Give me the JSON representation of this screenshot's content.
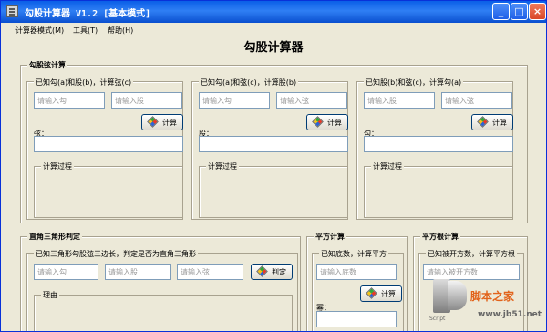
{
  "window": {
    "title": "勾股计算器 V1.2 [基本模式]"
  },
  "window_buttons": {
    "minimize": "_",
    "maximize": "□",
    "close": "×"
  },
  "menu": [
    "计算器模式(M)",
    "工具(T)",
    "帮助(H)"
  ],
  "app_title": "勾股计算器",
  "pyth_group": {
    "title": "勾股弦计算",
    "process_label": "计算过程",
    "calc_label": "计算",
    "sections": [
      {
        "title": "已知勾(a)和股(b)，计算弦(c)",
        "input1_placeholder": "请输入勾",
        "input2_placeholder": "请输入股",
        "result_label": "弦："
      },
      {
        "title": "已知勾(a)和弦(c)，计算股(b)",
        "input1_placeholder": "请输入勾",
        "input2_placeholder": "请输入弦",
        "result_label": "股："
      },
      {
        "title": "已知股(b)和弦(c)，计算勾(a)",
        "input1_placeholder": "请输入股",
        "input2_placeholder": "请输入弦",
        "result_label": "勾："
      }
    ]
  },
  "triangle_group": {
    "title": "直角三角形判定",
    "section_title": "已知三角形勾股弦三边长，判定是否为直角三角形",
    "input1_placeholder": "请输入勾",
    "input2_placeholder": "请输入股",
    "input3_placeholder": "请输入弦",
    "button_label": "判定",
    "reason_label": "理由"
  },
  "square_group": {
    "title": "平方计算",
    "section_title": "已知底数，计算平方",
    "input_placeholder": "请输入底数",
    "button_label": "计算",
    "result_label": "幂："
  },
  "sqrt_group": {
    "title": "平方根计算",
    "section_title": "已知被开方数，计算平方根",
    "input_placeholder": "请输入被开方数"
  },
  "watermark": {
    "text": "脚本之家",
    "url": "www.jb51.net",
    "script": "Script"
  }
}
